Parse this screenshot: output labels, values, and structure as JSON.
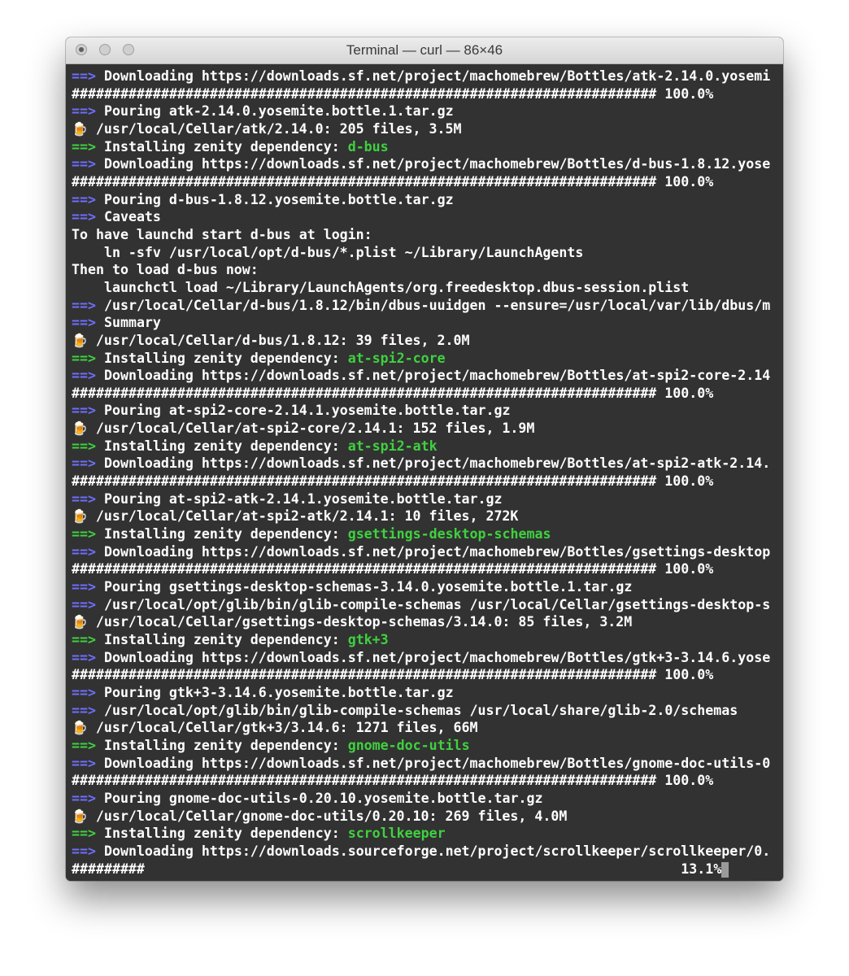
{
  "window": {
    "title": "Terminal — curl — 86×46"
  },
  "traffic_lights": [
    "close",
    "minimize",
    "zoom"
  ],
  "colors": {
    "background": "#323232",
    "text": "#ffffff",
    "arrow_blue": "#6e6efc",
    "arrow_green": "#3fd13f",
    "package_name": "#3fd13f"
  },
  "arrow": "==>",
  "beer_icon": "🍺",
  "lines": [
    {
      "type": "arrow",
      "arrow": "blue",
      "text": "Downloading https://downloads.sf.net/project/machomebrew/Bottles/atk-2.14.0.yosemi"
    },
    {
      "type": "plain",
      "text": "######################################################################## 100.0%"
    },
    {
      "type": "arrow",
      "arrow": "blue",
      "text": "Pouring atk-2.14.0.yosemite.bottle.1.tar.gz"
    },
    {
      "type": "beer",
      "text": "/usr/local/Cellar/atk/2.14.0: 205 files, 3.5M"
    },
    {
      "type": "arrow",
      "arrow": "green",
      "text": "Installing zenity dependency: ",
      "pkg": "d-bus"
    },
    {
      "type": "arrow",
      "arrow": "blue",
      "text": "Downloading https://downloads.sf.net/project/machomebrew/Bottles/d-bus-1.8.12.yose"
    },
    {
      "type": "plain",
      "text": "######################################################################## 100.0%"
    },
    {
      "type": "arrow",
      "arrow": "blue",
      "text": "Pouring d-bus-1.8.12.yosemite.bottle.tar.gz"
    },
    {
      "type": "arrow",
      "arrow": "blue",
      "text": "Caveats"
    },
    {
      "type": "plain",
      "text": "To have launchd start d-bus at login:"
    },
    {
      "type": "plain",
      "text": "    ln -sfv /usr/local/opt/d-bus/*.plist ~/Library/LaunchAgents"
    },
    {
      "type": "plain",
      "text": "Then to load d-bus now:"
    },
    {
      "type": "plain",
      "text": "    launchctl load ~/Library/LaunchAgents/org.freedesktop.dbus-session.plist"
    },
    {
      "type": "arrow",
      "arrow": "blue",
      "text": "/usr/local/Cellar/d-bus/1.8.12/bin/dbus-uuidgen --ensure=/usr/local/var/lib/dbus/m"
    },
    {
      "type": "arrow",
      "arrow": "blue",
      "text": "Summary"
    },
    {
      "type": "beer",
      "text": "/usr/local/Cellar/d-bus/1.8.12: 39 files, 2.0M"
    },
    {
      "type": "arrow",
      "arrow": "green",
      "text": "Installing zenity dependency: ",
      "pkg": "at-spi2-core"
    },
    {
      "type": "arrow",
      "arrow": "blue",
      "text": "Downloading https://downloads.sf.net/project/machomebrew/Bottles/at-spi2-core-2.14"
    },
    {
      "type": "plain",
      "text": "######################################################################## 100.0%"
    },
    {
      "type": "arrow",
      "arrow": "blue",
      "text": "Pouring at-spi2-core-2.14.1.yosemite.bottle.tar.gz"
    },
    {
      "type": "beer",
      "text": "/usr/local/Cellar/at-spi2-core/2.14.1: 152 files, 1.9M"
    },
    {
      "type": "arrow",
      "arrow": "green",
      "text": "Installing zenity dependency: ",
      "pkg": "at-spi2-atk"
    },
    {
      "type": "arrow",
      "arrow": "blue",
      "text": "Downloading https://downloads.sf.net/project/machomebrew/Bottles/at-spi2-atk-2.14."
    },
    {
      "type": "plain",
      "text": "######################################################################## 100.0%"
    },
    {
      "type": "arrow",
      "arrow": "blue",
      "text": "Pouring at-spi2-atk-2.14.1.yosemite.bottle.tar.gz"
    },
    {
      "type": "beer",
      "text": "/usr/local/Cellar/at-spi2-atk/2.14.1: 10 files, 272K"
    },
    {
      "type": "arrow",
      "arrow": "green",
      "text": "Installing zenity dependency: ",
      "pkg": "gsettings-desktop-schemas"
    },
    {
      "type": "arrow",
      "arrow": "blue",
      "text": "Downloading https://downloads.sf.net/project/machomebrew/Bottles/gsettings-desktop"
    },
    {
      "type": "plain",
      "text": "######################################################################## 100.0%"
    },
    {
      "type": "arrow",
      "arrow": "blue",
      "text": "Pouring gsettings-desktop-schemas-3.14.0.yosemite.bottle.1.tar.gz"
    },
    {
      "type": "arrow",
      "arrow": "blue",
      "text": "/usr/local/opt/glib/bin/glib-compile-schemas /usr/local/Cellar/gsettings-desktop-s"
    },
    {
      "type": "beer",
      "text": "/usr/local/Cellar/gsettings-desktop-schemas/3.14.0: 85 files, 3.2M"
    },
    {
      "type": "arrow",
      "arrow": "green",
      "text": "Installing zenity dependency: ",
      "pkg": "gtk+3"
    },
    {
      "type": "arrow",
      "arrow": "blue",
      "text": "Downloading https://downloads.sf.net/project/machomebrew/Bottles/gtk+3-3.14.6.yose"
    },
    {
      "type": "plain",
      "text": "######################################################################## 100.0%"
    },
    {
      "type": "arrow",
      "arrow": "blue",
      "text": "Pouring gtk+3-3.14.6.yosemite.bottle.tar.gz"
    },
    {
      "type": "arrow",
      "arrow": "blue",
      "text": "/usr/local/opt/glib/bin/glib-compile-schemas /usr/local/share/glib-2.0/schemas"
    },
    {
      "type": "beer",
      "text": "/usr/local/Cellar/gtk+3/3.14.6: 1271 files, 66M"
    },
    {
      "type": "arrow",
      "arrow": "green",
      "text": "Installing zenity dependency: ",
      "pkg": "gnome-doc-utils"
    },
    {
      "type": "arrow",
      "arrow": "blue",
      "text": "Downloading https://downloads.sf.net/project/machomebrew/Bottles/gnome-doc-utils-0"
    },
    {
      "type": "plain",
      "text": "######################################################################## 100.0%"
    },
    {
      "type": "arrow",
      "arrow": "blue",
      "text": "Pouring gnome-doc-utils-0.20.10.yosemite.bottle.tar.gz"
    },
    {
      "type": "beer",
      "text": "/usr/local/Cellar/gnome-doc-utils/0.20.10: 269 files, 4.0M"
    },
    {
      "type": "arrow",
      "arrow": "green",
      "text": "Installing zenity dependency: ",
      "pkg": "scrollkeeper"
    },
    {
      "type": "arrow",
      "arrow": "blue",
      "text": "Downloading https://downloads.sourceforge.net/project/scrollkeeper/scrollkeeper/0."
    },
    {
      "type": "progress",
      "text": "#########                                                                  13.1%",
      "cursor": true
    }
  ]
}
